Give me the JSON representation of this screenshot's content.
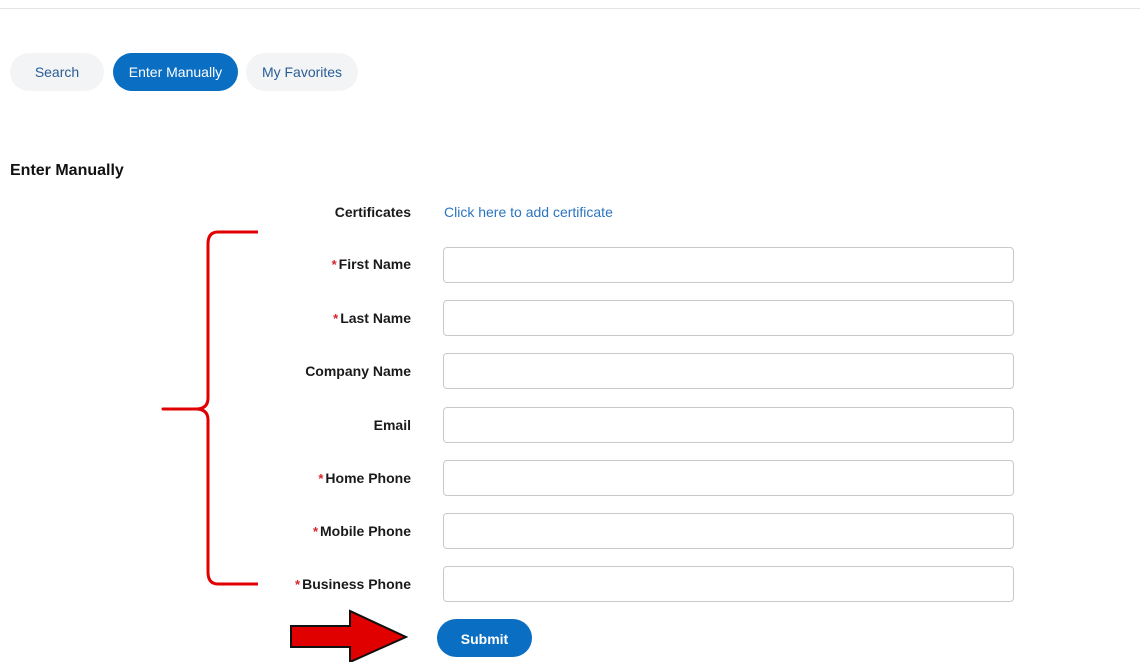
{
  "tabs": [
    {
      "label": "Search",
      "active": false
    },
    {
      "label": "Enter Manually",
      "active": true
    },
    {
      "label": "My Favorites",
      "active": false
    }
  ],
  "section_title": "Enter Manually",
  "certificates": {
    "label": "Certificates",
    "link_text": "Click here to add certificate"
  },
  "fields": [
    {
      "label": "First Name",
      "required": true,
      "value": ""
    },
    {
      "label": "Last Name",
      "required": true,
      "value": ""
    },
    {
      "label": "Company Name",
      "required": false,
      "value": ""
    },
    {
      "label": "Email",
      "required": false,
      "value": ""
    },
    {
      "label": "Home Phone",
      "required": true,
      "value": ""
    },
    {
      "label": "Mobile Phone",
      "required": true,
      "value": ""
    },
    {
      "label": "Business Phone",
      "required": true,
      "value": ""
    }
  ],
  "required_marker": "*",
  "submit_label": "Submit",
  "colors": {
    "accent": "#0a6fc2",
    "link": "#2b75c0",
    "required": "#d8222a",
    "annotation": "#e00000"
  }
}
